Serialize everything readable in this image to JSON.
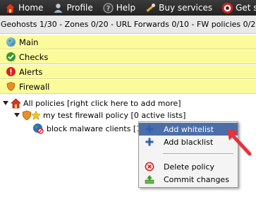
{
  "nav": {
    "home": "Home",
    "profile": "Profile",
    "help": "Help",
    "buy": "Buy services",
    "get": "Get s"
  },
  "status_line": "Geohosts 1/30 - Zones 0/20 - URL Forwards 0/10 - FW policies 0/2",
  "sections": {
    "main": "Main",
    "checks": "Checks",
    "alerts": "Alerts",
    "firewall": "Firewall"
  },
  "tree": {
    "root": "All policies [right click here to add more]",
    "policy": "my test firewall policy [0 active lists]",
    "list": "block malware clients [1"
  },
  "context_menu": {
    "add_whitelist": "Add whitelist",
    "add_blacklist": "Add blacklist",
    "delete_policy": "Delete policy",
    "commit_changes": "Commit changes"
  },
  "colors": {
    "topbar": "#2b2b2b",
    "section_bg": "#fbfb9b",
    "menu_highlight": "#4c6ea8",
    "pointer": "#e8323c"
  },
  "icons": {
    "home": "house-icon",
    "profile": "user-icon",
    "help": "question-icon",
    "buy": "wrench-icon",
    "get": "lifebuoy-icon"
  }
}
